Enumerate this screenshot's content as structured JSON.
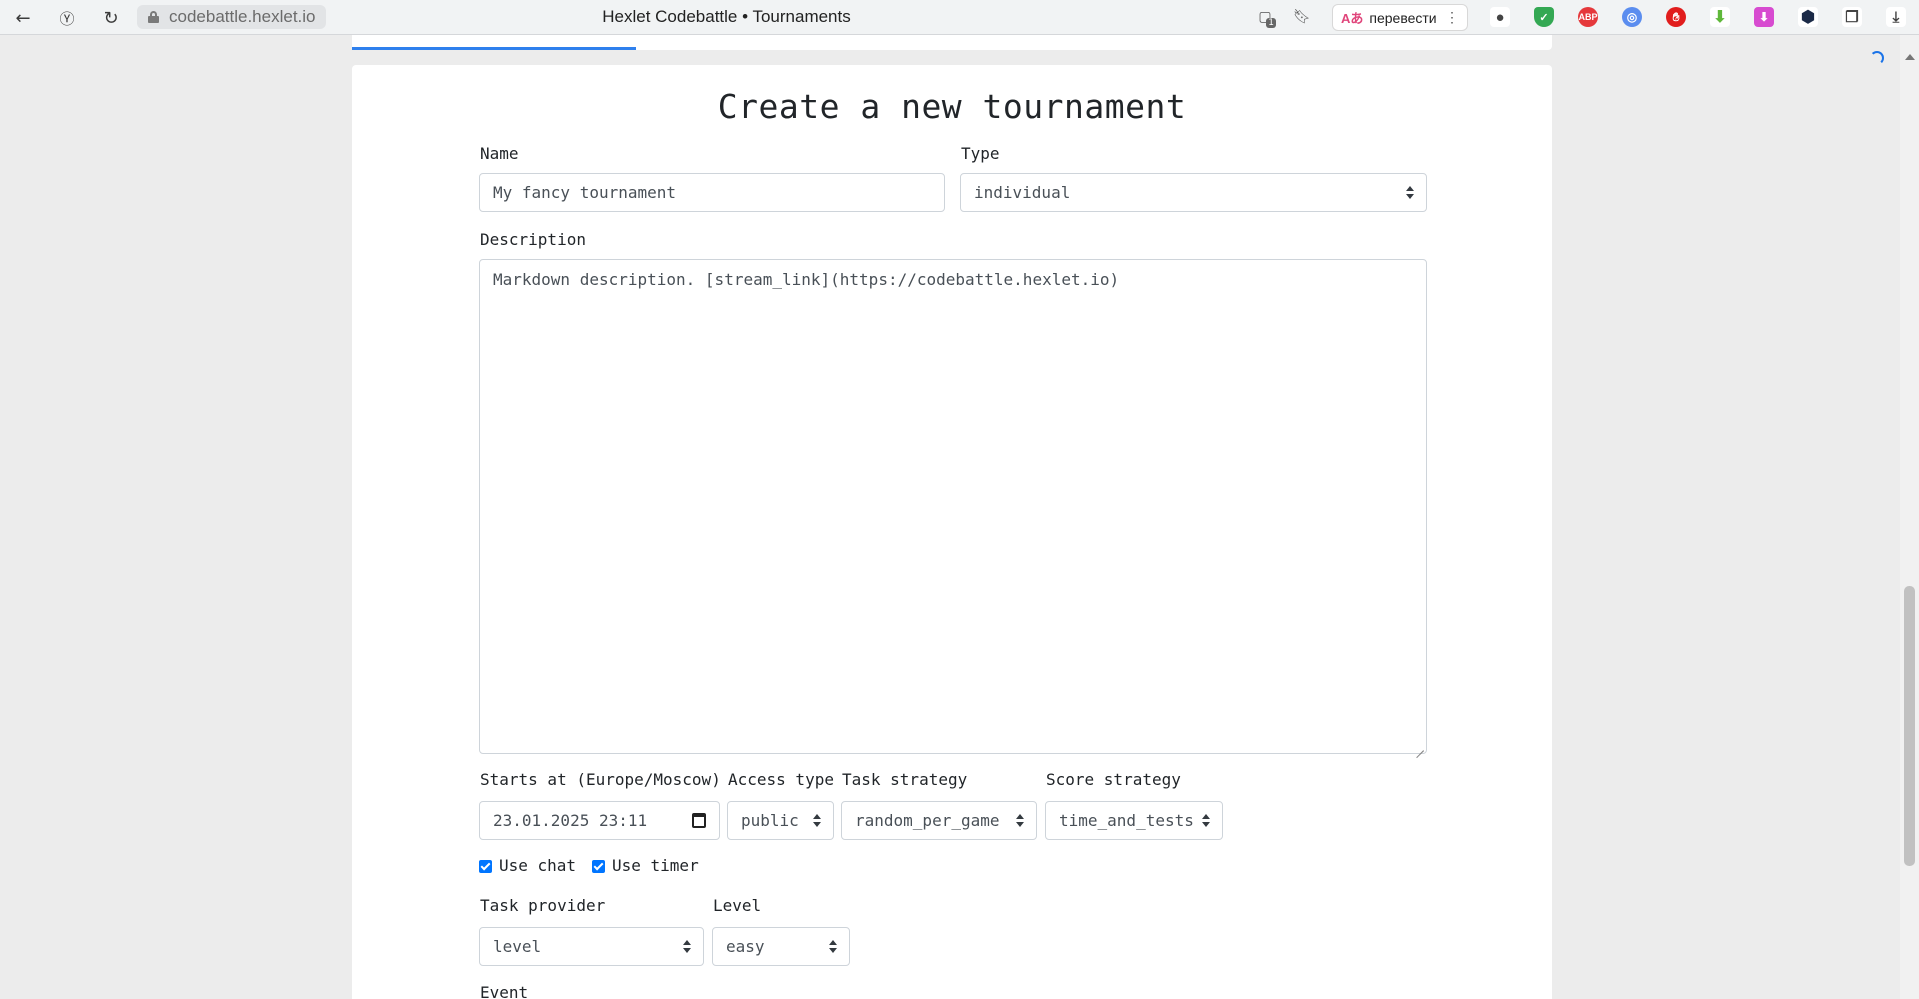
{
  "browser": {
    "url": "codebattle.hexlet.io",
    "tab_title": "Hexlet Codebattle • Tournaments",
    "translate_label": "перевести",
    "translate_icon": "Aあ",
    "adblock_label": "ABP",
    "badge_count": "1"
  },
  "form": {
    "title": "Create a new tournament",
    "name": {
      "label": "Name",
      "value": "My fancy tournament"
    },
    "type": {
      "label": "Type",
      "value": "individual"
    },
    "description": {
      "label": "Description",
      "value": "Markdown description. [stream_link](https://codebattle.hexlet.io)"
    },
    "starts_at": {
      "label": "Starts at (Europe/Moscow)",
      "value": "23.01.2025 23:11"
    },
    "access_type": {
      "label": "Access type",
      "value": "public"
    },
    "task_strategy": {
      "label": "Task strategy",
      "value": "random_per_game"
    },
    "score_strategy": {
      "label": "Score strategy",
      "value": "time_and_tests"
    },
    "use_chat": {
      "label": "Use chat",
      "checked": true
    },
    "use_timer": {
      "label": "Use timer",
      "checked": true
    },
    "task_provider": {
      "label": "Task provider",
      "value": "level"
    },
    "level": {
      "label": "Level",
      "value": "easy"
    },
    "event": {
      "label": "Event"
    }
  },
  "colors": {
    "accent": "#2f80ed",
    "checkbox": "#0075ff",
    "page_bg": "#ececec"
  }
}
